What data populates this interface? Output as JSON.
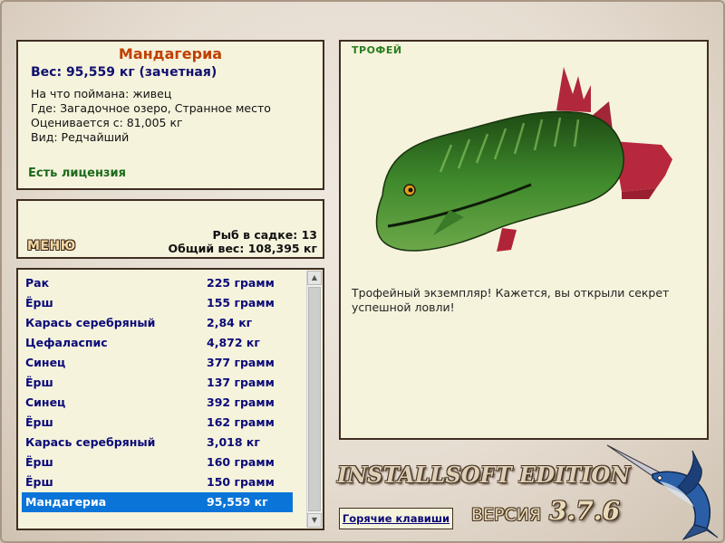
{
  "info": {
    "fish_name": "Мандагериа",
    "weight": "Вес: 95,559 кг (зачетная)",
    "bait": "На что поймана: живец",
    "location": "Где: Загадочное озеро, Странное место",
    "rated_from": "Оценивается с: 81,005 кг",
    "rarity": "Вид: Редчайший",
    "license": "Есть лицензия"
  },
  "menu": {
    "button_label": "МЕНЮ",
    "fish_in_keepnet": "Рыб в садке: 13",
    "total_weight": "Общий вес: 108,395 кг"
  },
  "fish_list": [
    {
      "name": "Рак",
      "weight": "225 грамм"
    },
    {
      "name": "Ёрш",
      "weight": "155 грамм"
    },
    {
      "name": "Карась серебряный",
      "weight": "2,84 кг"
    },
    {
      "name": "Цефаласпис",
      "weight": "4,872 кг"
    },
    {
      "name": "Синец",
      "weight": "377 грамм"
    },
    {
      "name": "Ёрш",
      "weight": "137 грамм"
    },
    {
      "name": "Синец",
      "weight": "392 грамм"
    },
    {
      "name": "Ёрш",
      "weight": "162 грамм"
    },
    {
      "name": "Карась серебряный",
      "weight": "3,018 кг"
    },
    {
      "name": "Ёрш",
      "weight": "160 грамм"
    },
    {
      "name": "Ёрш",
      "weight": "150 грамм"
    },
    {
      "name": "Мандагериа",
      "weight": "95,559 кг",
      "selected": true
    }
  ],
  "trophy": {
    "label": "ТРОФЕЙ",
    "description": "Трофейный экземпляр! Кажется, вы открыли секрет успешной ловли!"
  },
  "footer": {
    "hotkeys": "Горячие клавиши",
    "edition": "INSTALLSOFT EDITION",
    "version_label": "ВЕРСИЯ",
    "version_number": "3.7.6"
  },
  "icons": {
    "trophy_fish": "fish-illustration",
    "logo": "marlin-logo"
  },
  "colors": {
    "panel_bg": "#f6f3dc",
    "panel_border": "#3f2d22",
    "selection": "#0a74d8",
    "list_text": "#0a0a78",
    "fish_name": "#c04000",
    "license": "#1c6a1c"
  }
}
